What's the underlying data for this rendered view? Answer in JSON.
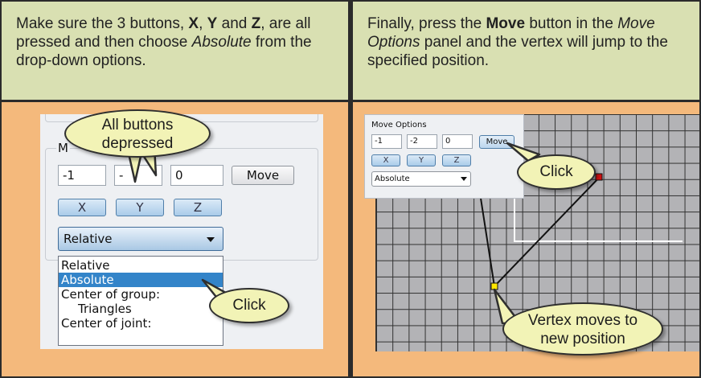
{
  "left_panel": {
    "caption_parts": [
      "Make sure the 3 buttons, ",
      "X",
      ", ",
      "Y",
      " and ",
      "Z",
      ", are all pressed and then choose ",
      "Absolute",
      " from the drop-down options."
    ],
    "screenshot": {
      "group_label": "M",
      "fields": [
        "-1",
        "-",
        "0"
      ],
      "move_label": "Move",
      "toggles": [
        "X",
        "Y",
        "Z"
      ],
      "select_value": "Relative",
      "options": [
        "Relative",
        "Absolute",
        "Center of group:",
        "Triangles",
        "Center of joint:"
      ],
      "selected_option": "Absolute"
    },
    "callout_buttons": "All buttons depressed",
    "callout_click": "Click"
  },
  "right_panel": {
    "caption_parts": [
      "Finally, press the ",
      "Move",
      " button in the ",
      "Move Options",
      " panel and the vertex will jump to the specified position."
    ],
    "move_options": {
      "title": "Move Options",
      "fields": [
        "-1",
        "-2",
        "0"
      ],
      "move_label": "Move",
      "toggles": [
        "X",
        "Y",
        "Z"
      ],
      "select_value": "Absolute"
    },
    "callout_click": "Click",
    "callout_vertex": "Vertex moves to new position"
  },
  "colors": {
    "caption_bg": "#d9e0b2",
    "panel_bg": "#f4b97c",
    "callout_bg": "#f2f3b6",
    "selection_blue": "#3384c9",
    "vertex_yellow": "#ffe600",
    "vertex_red": "#d01010"
  }
}
